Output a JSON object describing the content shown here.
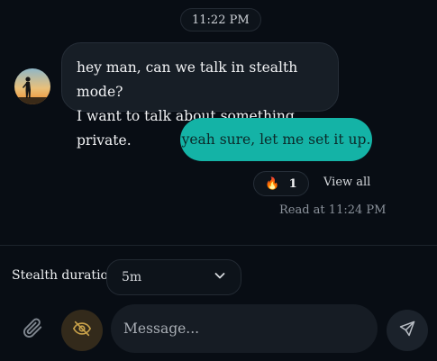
{
  "chat": {
    "timestamp": "11:22 PM",
    "incoming": {
      "line1": "hey man, can we talk in stealth mode?",
      "line2": "I want to talk about something private."
    },
    "outgoing": {
      "text": "yeah sure, let me set it up."
    },
    "reaction": {
      "emoji": "🔥",
      "count": "1"
    },
    "view_all": "View all",
    "read_status": "Read at 11:24 PM"
  },
  "composer": {
    "stealth_label": "Stealth duration",
    "stealth_value": "5m",
    "message_placeholder": "Message..."
  },
  "icons": {
    "attach": "paperclip-icon",
    "stealth": "eye-off-icon",
    "send": "send-icon",
    "dropdown": "chevron-down-icon"
  },
  "colors": {
    "background": "#080d14",
    "incoming_bubble": "#171e26",
    "outgoing_bubble": "#14b3a6",
    "stealth_button": "#332a1b",
    "stealth_icon": "#c9a24a"
  }
}
